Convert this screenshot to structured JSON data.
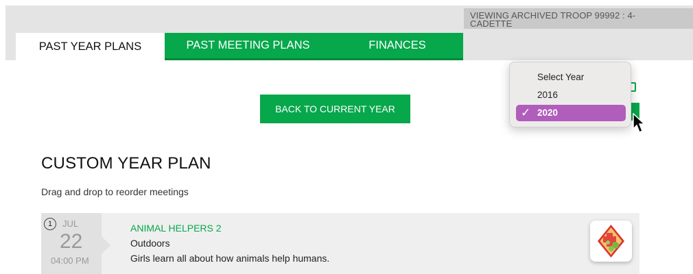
{
  "archive_banner": "VIEWING ARCHIVED TROOP 99992 : 4-CADETTE",
  "tabs": [
    {
      "label": "PAST YEAR PLANS"
    },
    {
      "label": "PAST MEETING PLANS"
    },
    {
      "label": "FINANCES"
    }
  ],
  "back_button": "BACK TO CURRENT YEAR",
  "year_dropdown": {
    "options": [
      "Select Year",
      "2016",
      "2020"
    ],
    "selected": "2020",
    "check_glyph": "✓"
  },
  "page_title": "CUSTOM YEAR PLAN",
  "subtitle": "Drag and drop to reorder meetings",
  "meetings": [
    {
      "number": "1",
      "month": "JUL",
      "day": "22",
      "time": "04:00 PM",
      "title": "ANIMAL HELPERS 2",
      "category": "Outdoors",
      "description": "Girls learn all about how animals help humans.",
      "badge_icon": "animal-helpers-badge-icon"
    }
  ],
  "colors": {
    "brand_green": "#07a74b",
    "dropdown_highlight": "#b05dbb",
    "band_gray": "#e4e4e4"
  }
}
